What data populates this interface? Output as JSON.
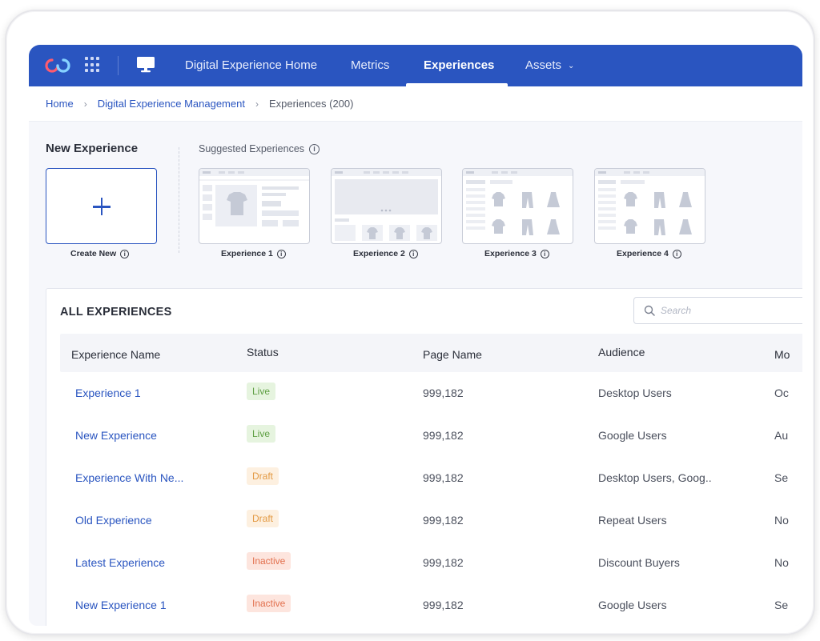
{
  "nav": {
    "items": [
      {
        "label": "Digital Experience Home"
      },
      {
        "label": "Metrics"
      },
      {
        "label": "Experiences"
      },
      {
        "label": "Assets"
      }
    ],
    "active": "Experiences",
    "accent_color": "#2a55c0"
  },
  "breadcrumb": {
    "home": "Home",
    "section": "Digital Experience Management",
    "current": "Experiences (200)"
  },
  "new_experience": {
    "title": "New Experience",
    "create_label": "Create New"
  },
  "suggested": {
    "title": "Suggested Experiences",
    "items": [
      {
        "label": "Experience 1"
      },
      {
        "label": "Experience 2"
      },
      {
        "label": "Experience 3"
      },
      {
        "label": "Experience 4"
      }
    ]
  },
  "table": {
    "title": "ALL EXPERIENCES",
    "search_placeholder": "Search",
    "columns": [
      "Experience Name",
      "Status",
      "Page Name",
      "Audience",
      "Mo"
    ],
    "rows": [
      {
        "name": "Experience 1",
        "status": "Live",
        "page": "999,182",
        "audience": "Desktop Users",
        "modified": "Oc"
      },
      {
        "name": "New Experience",
        "status": "Live",
        "page": "999,182",
        "audience": "Google Users",
        "modified": "Au"
      },
      {
        "name": "Experience With Ne...",
        "status": "Draft",
        "page": "999,182",
        "audience": "Desktop Users, Goog..",
        "modified": "Se"
      },
      {
        "name": "Old Experience",
        "status": "Draft",
        "page": "999,182",
        "audience": "Repeat Users",
        "modified": "No"
      },
      {
        "name": "Latest Experience",
        "status": "Inactive",
        "page": "999,182",
        "audience": "Discount Buyers",
        "modified": "No"
      },
      {
        "name": "New Experience 1",
        "status": "Inactive",
        "page": "999,182",
        "audience": "Google Users",
        "modified": "Se"
      }
    ]
  },
  "status_colors": {
    "Live": "#5e9f43",
    "Draft": "#e39a44",
    "Inactive": "#e2704e"
  },
  "icons": [
    "logo-icon",
    "app-grid-icon",
    "monitor-icon",
    "chevron-down-icon",
    "info-icon",
    "search-icon",
    "plus-icon",
    "tshirt-icon",
    "pants-icon",
    "dress-icon"
  ]
}
